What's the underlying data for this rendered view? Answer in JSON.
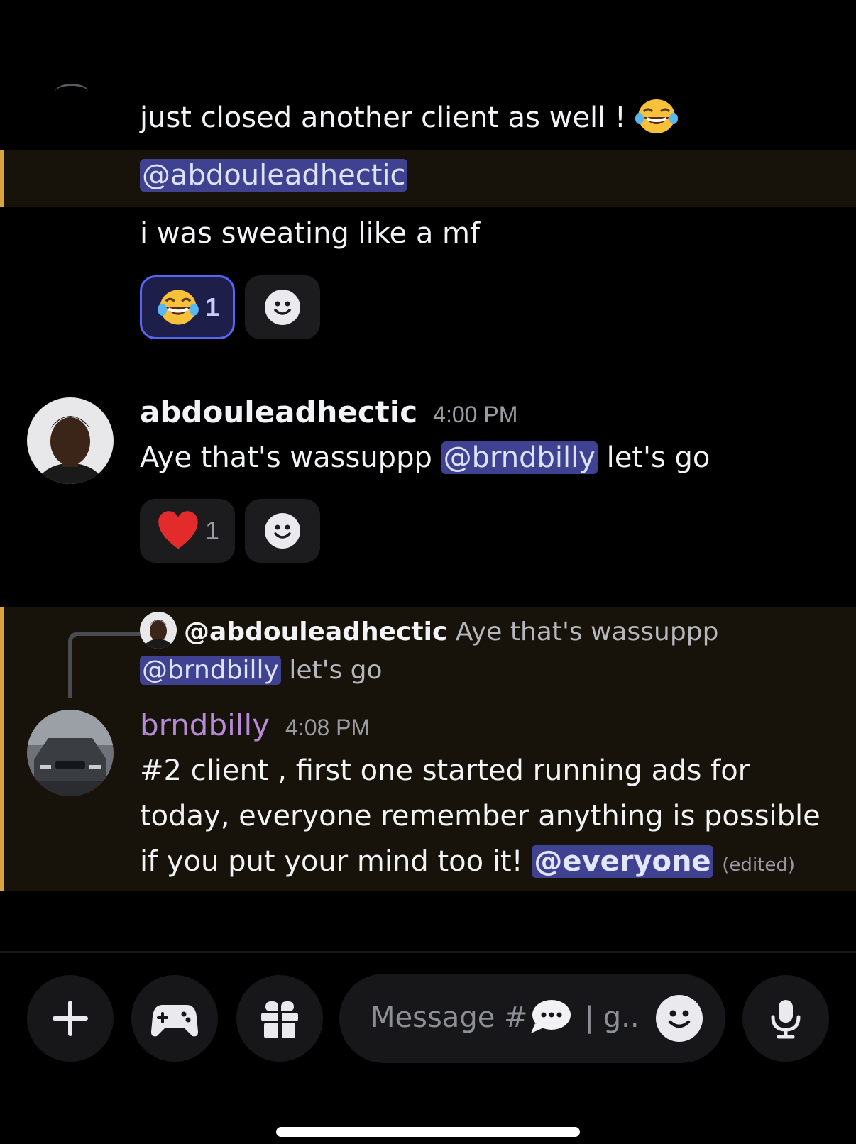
{
  "messages": {
    "prev": {
      "line1": "just closed another client as well !",
      "mention": "@abdouleadhectic",
      "line3": "i was sweating like a mf",
      "reaction_count": "1"
    },
    "abdou": {
      "username": "abdouleadhectic",
      "time": "4:00 PM",
      "text_before": "Aye that's wassuppp",
      "mention": "@brndbilly",
      "text_after": "let's go",
      "reaction_count": "1"
    },
    "reply": {
      "user": "@abdouleadhectic",
      "text1": "Aye that's wassuppp",
      "mention": "@brndbilly",
      "text2": "let's go"
    },
    "billy": {
      "username": "brndbilly",
      "time": "4:08 PM",
      "line1": "#2 client , first one started running ads for",
      "line2": "today, everyone remember anything is possible",
      "line3": "if you put your mind too it!",
      "mention": "@everyone",
      "edited": "(edited)"
    }
  },
  "composer": {
    "placeholder_prefix": "Message #",
    "placeholder_suffix": "| g.."
  },
  "colors": {
    "mention_bg": "#3e4290",
    "highlight_bg": "#17130a",
    "highlight_bar": "#d9a43f",
    "brndbilly_name": "#b58ad6",
    "accent": "#5865f2"
  }
}
